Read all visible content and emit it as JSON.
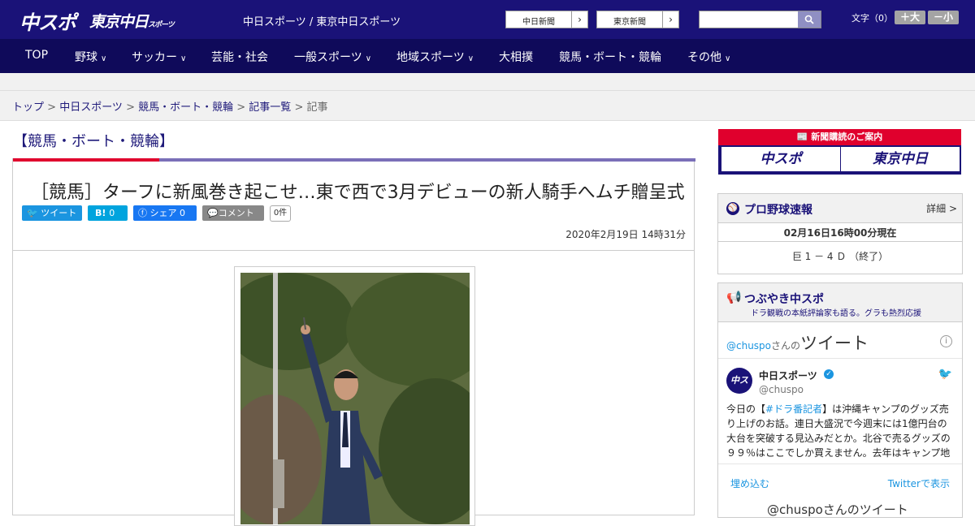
{
  "header": {
    "logo": "中スポ",
    "logo2": "東京中日",
    "logo2_small": "スポーツ",
    "title": "中日スポーツ / 東京中日スポーツ",
    "btn1": "中日新聞",
    "btn2": "東京新聞",
    "font_label": "文字（0）",
    "font_plus": "＋大",
    "font_minus": "－小"
  },
  "nav": [
    "TOP",
    "野球",
    "サッカー",
    "芸能・社会",
    "一般スポーツ",
    "地域スポーツ",
    "大相撲",
    "競馬・ボート・競輪",
    "その他"
  ],
  "breadcrumb": {
    "items": [
      "トップ",
      "中日スポーツ",
      "競馬・ボート・競輪",
      "記事一覧"
    ],
    "current": "記事",
    "sep": " > "
  },
  "section": "【競馬・ボート・競輪】",
  "article": {
    "title": "［競馬］ターフに新風巻き起こせ…東で西で3月デビューの新人騎手へムチ贈呈式",
    "tweet": "ツイート",
    "hatena": "B!",
    "hatena_count": "0",
    "share": "シェア",
    "share_count": "0",
    "comment": "コメント",
    "comment_count": "0件",
    "date": "2020年2月19日 14時31分"
  },
  "sidebar": {
    "ad_title": "新聞購読のご案内",
    "ad_b1": "中スポ",
    "ad_b2": "東京中日",
    "baseball": {
      "title": "プロ野球速報",
      "more": "詳細 >",
      "time": "02月16日16時00分現在",
      "score": "巨 1 － 4 Ｄ （終了）"
    },
    "tweet": {
      "title": "つぶやき中スポ",
      "subtitle": "ドラ観戦の本紙評論家も語る。グラも熱烈応援",
      "handle_prefix": "@chuspo",
      "handle_suffix": "さんの",
      "heading": "ツイート",
      "user": "中日スポーツ",
      "user_handle": "@chuspo",
      "body_pre": "今日の【",
      "hashtag": "#ドラ番記者",
      "body": "】は沖縄キャンプのグッズ売り上げのお話。連日大盛況で今週末には1億円台の大台を突破する見込みだとか。北谷で売るグッズの９９％はここでしか買えません。去年はキャンプ地",
      "embed": "埋め込む",
      "view": "Twitterで表示",
      "bottom": "@chuspoさんのツイート"
    }
  },
  "colors": {
    "brand": "#1a1278",
    "accent": "#e0002d"
  }
}
